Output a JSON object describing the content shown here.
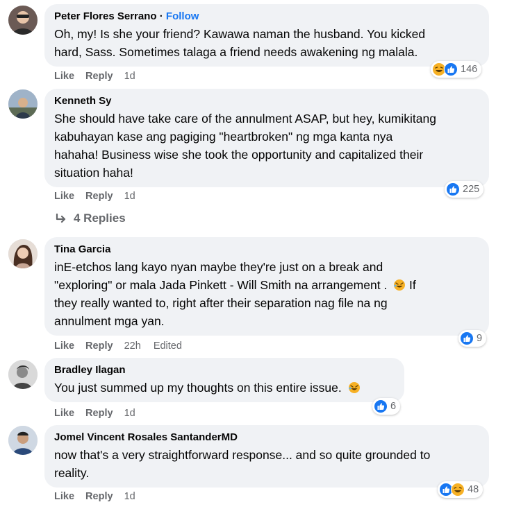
{
  "comments": [
    {
      "author": "Peter Flores Serrano",
      "separator": " · ",
      "follow_label": "Follow",
      "lines": [
        "Oh, my! Is she your friend? Kawawa naman the husband. You kicked",
        "hard, Sass. Sometimes talaga a friend needs awakening ng malala."
      ],
      "like_label": "Like",
      "reply_label": "Reply",
      "time": "1d",
      "reactions": [
        "haha-icon",
        "like-icon"
      ],
      "reaction_count": "146"
    },
    {
      "author": "Kenneth Sy",
      "lines": [
        "She should have take care of the annulment ASAP, but hey, kumikitang",
        "kabuhayan kase ang pagiging \"heartbroken\" ng mga kanta nya",
        "hahaha! Business wise she took the opportunity and capitalized their",
        "situation haha!"
      ],
      "like_label": "Like",
      "reply_label": "Reply",
      "time": "1d",
      "reactions": [
        "like-icon"
      ],
      "reaction_count": "225",
      "replies_label": "4 Replies"
    },
    {
      "author": "Tina Garcia",
      "lines": [
        "inE-etchos lang kayo nyan maybe they're just on a break and",
        "\"exploring\" or mala Jada Pinkett - Will Smith na arrangement .",
        "If",
        "they really wanted to, right after their separation nag file na ng",
        "annulment mga yan."
      ],
      "like_label": "Like",
      "reply_label": "Reply",
      "time": "22h",
      "edited_label": "Edited",
      "reactions": [
        "like-icon"
      ],
      "reaction_count": "9"
    },
    {
      "author": "Bradley Ilagan",
      "lines": [
        "You just summed up my thoughts on this entire issue."
      ],
      "like_label": "Like",
      "reply_label": "Reply",
      "time": "1d",
      "reactions": [
        "like-icon"
      ],
      "reaction_count": "6"
    },
    {
      "author": "Jomel Vincent Rosales SantanderMD",
      "lines": [
        "now that's a very straightforward response... and so quite grounded to",
        "reality."
      ],
      "like_label": "Like",
      "reply_label": "Reply",
      "time": "1d",
      "reactions": [
        "like-icon",
        "haha-icon"
      ],
      "reaction_count": "48"
    }
  ],
  "colors": {
    "bubble": "#f0f2f5",
    "secondary_text": "#65676b",
    "like_blue": "#1877f2",
    "haha_yellow": "#f7b125"
  }
}
